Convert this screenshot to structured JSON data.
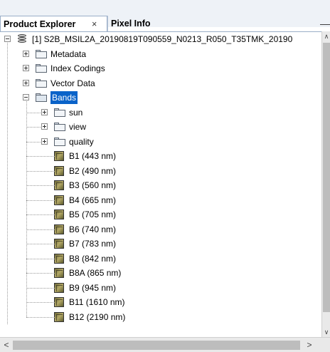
{
  "tabs": [
    {
      "label": "Product Explorer",
      "active": true,
      "close": "×"
    },
    {
      "label": "Pixel Info",
      "active": false
    }
  ],
  "minimize_glyph": "—",
  "product": {
    "label": "[1] S2B_MSIL2A_20190819T090559_N0213_R050_T35TMK_20190",
    "children": [
      {
        "label": "Metadata",
        "type": "folder",
        "expanded": false
      },
      {
        "label": "Index Codings",
        "type": "folder",
        "expanded": false
      },
      {
        "label": "Vector Data",
        "type": "folder",
        "expanded": false
      },
      {
        "label": "Bands",
        "type": "folder",
        "expanded": true,
        "selected": true,
        "children": [
          {
            "label": "sun",
            "type": "folder"
          },
          {
            "label": "view",
            "type": "folder"
          },
          {
            "label": "quality",
            "type": "folder"
          },
          {
            "label": "B1 (443 nm)",
            "type": "band"
          },
          {
            "label": "B2 (490 nm)",
            "type": "band"
          },
          {
            "label": "B3 (560 nm)",
            "type": "band"
          },
          {
            "label": "B4 (665 nm)",
            "type": "band"
          },
          {
            "label": "B5 (705 nm)",
            "type": "band"
          },
          {
            "label": "B6 (740 nm)",
            "type": "band"
          },
          {
            "label": "B7 (783 nm)",
            "type": "band"
          },
          {
            "label": "B8 (842 nm)",
            "type": "band"
          },
          {
            "label": "B8A (865 nm)",
            "type": "band"
          },
          {
            "label": "B9 (945 nm)",
            "type": "band"
          },
          {
            "label": "B11 (1610 nm)",
            "type": "band"
          },
          {
            "label": "B12 (2190 nm)",
            "type": "band"
          }
        ]
      }
    ]
  },
  "scroll": {
    "up": "∧",
    "down": "∨",
    "left": "<",
    "right": ">"
  },
  "colors": {
    "selection": "#0a63c9",
    "tab_border": "#9aaec8"
  }
}
